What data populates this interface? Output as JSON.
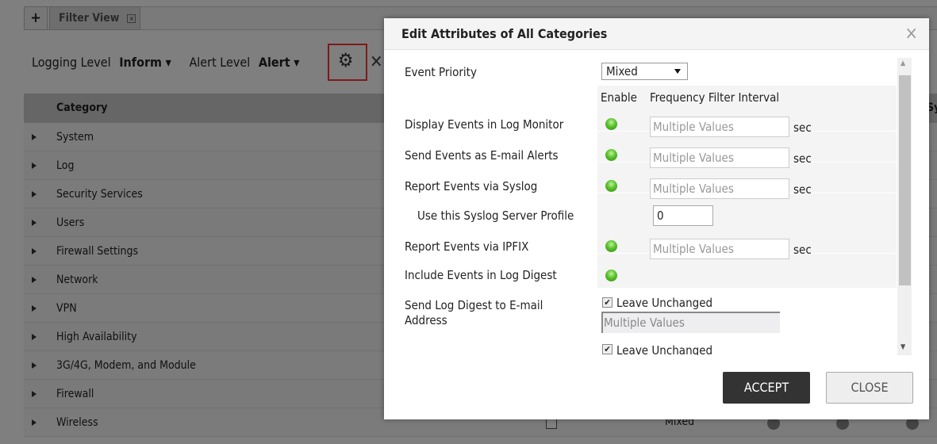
{
  "tabs": {
    "add": "+",
    "filter_view": "Filter View",
    "close": "×"
  },
  "toolbar": {
    "logging_label": "Logging Level",
    "logging_value": "Inform",
    "alert_label": "Alert Level",
    "alert_value": "Alert",
    "close": "✕"
  },
  "table": {
    "header": "Category",
    "header_right": "Sys",
    "rows": [
      "System",
      "Log",
      "Security Services",
      "Users",
      "Firewall Settings",
      "Network",
      "VPN",
      "High Availability",
      "3G/4G, Modem, and Module",
      "Firewall",
      "Wireless"
    ],
    "wireless_priority": "Mixed"
  },
  "dialog": {
    "title": "Edit Attributes of All Categories",
    "close": "×",
    "event_priority_label": "Event Priority",
    "event_priority_value": "Mixed",
    "col_enable": "Enable",
    "col_freq": "Frequency Filter Interval",
    "rows": [
      {
        "label": "Display Events in Log Monitor",
        "placeholder": "Multiple Values",
        "unit": "sec"
      },
      {
        "label": "Send Events as E-mail Alerts",
        "placeholder": "Multiple Values",
        "unit": "sec"
      },
      {
        "label": "Report Events via Syslog",
        "placeholder": "Multiple Values",
        "unit": "sec"
      },
      {
        "label": "Report Events via IPFIX",
        "placeholder": "Multiple Values",
        "unit": "sec"
      }
    ],
    "syslog_profile_label": "Use this Syslog Server Profile",
    "syslog_profile_value": "0",
    "digest_label": "Include Events in Log Digest",
    "digest_email_label": "Send Log Digest to E-mail Address",
    "leave_unchanged": "Leave Unchanged",
    "digest_email_placeholder": "Multiple Values",
    "accept": "ACCEPT",
    "close_btn": "CLOSE"
  },
  "colors": {
    "accent_red": "#f33",
    "accept_bg": "#333",
    "enabled_green": "#5ac22a"
  }
}
